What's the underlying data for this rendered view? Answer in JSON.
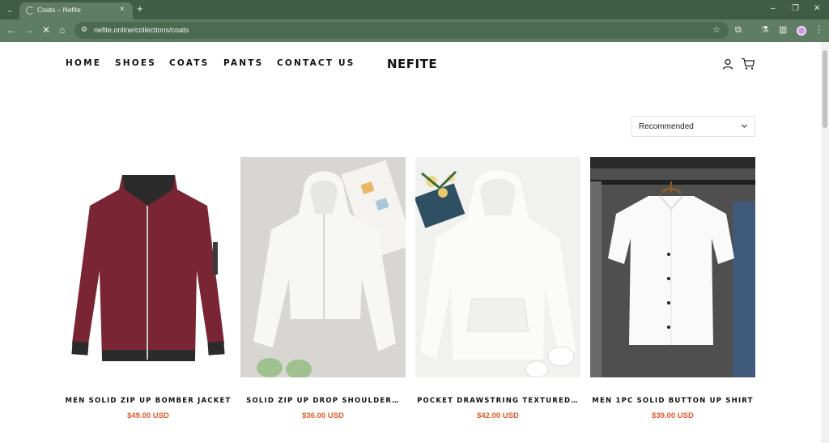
{
  "browser": {
    "tab_title": "Coats – Nefite",
    "tab_close": "×",
    "new_tab": "+",
    "url": "nefite.online/collections/coats",
    "window_controls": [
      "–",
      "❐",
      "✕"
    ]
  },
  "header": {
    "nav": [
      "HOME",
      "SHOES",
      "COATS",
      "PANTS",
      "CONTACT US"
    ],
    "logo": "NEFITE",
    "icons": [
      "account-icon",
      "cart-icon"
    ]
  },
  "sort": {
    "selected": "Recommended"
  },
  "products": [
    {
      "title": "MEN SOLID ZIP UP BOMBER JACKET",
      "price": "$49.00 USD",
      "image": "maroon-bomber-jacket"
    },
    {
      "title": "SOLID ZIP UP DROP SHOULDER…",
      "price": "$36.00 USD",
      "image": "white-cropped-zip-hoodie"
    },
    {
      "title": "POCKET DRAWSTRING TEXTURED…",
      "price": "$42.00 USD",
      "image": "white-textured-hoodie"
    },
    {
      "title": "MEN 1PC SOLID BUTTON UP SHIRT",
      "price": "$39.00 USD",
      "image": "white-button-up-shirt"
    }
  ],
  "colors": {
    "browser_frame": "#3f5c44",
    "toolbar": "#5f7d62",
    "price": "#e15a2a",
    "text": "#111111"
  }
}
